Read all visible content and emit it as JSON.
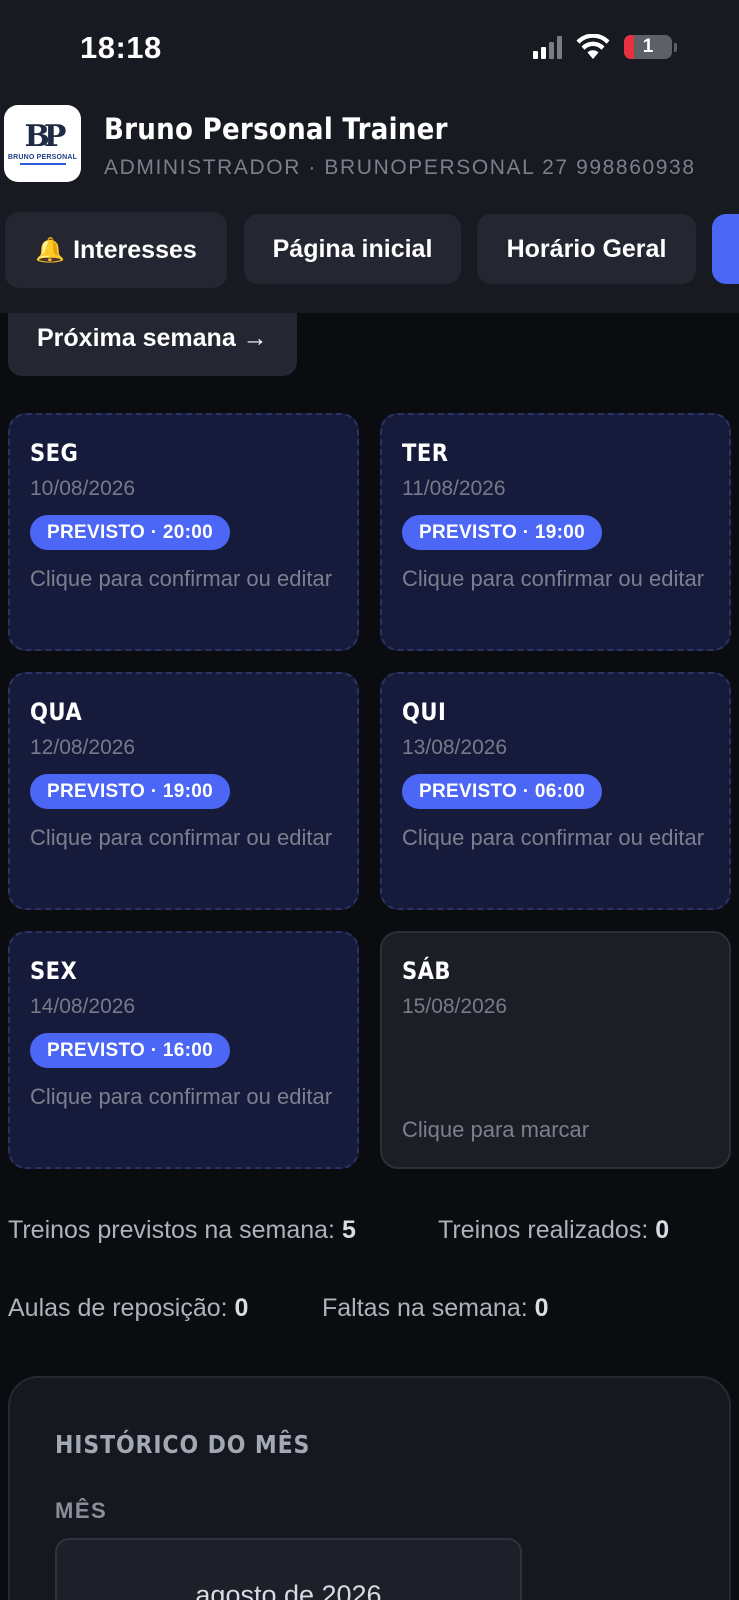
{
  "status_bar": {
    "time": "18:18",
    "battery": "1"
  },
  "header": {
    "logo_text": "BRUNO PERSONAL",
    "title": "Bruno Personal Trainer",
    "subtitle": "ADMINISTRADOR · BRUNOPERSONAL 27 998860938"
  },
  "nav": {
    "interesses": "Interesses",
    "inicial": "Página inicial",
    "horario": "Horário Geral"
  },
  "week_nav": {
    "next": "Próxima semana →"
  },
  "days": [
    {
      "name": "SEG",
      "date": "10/08/2026",
      "badge": "PREVISTO · 20:00",
      "hint": "Clique para confirmar ou editar"
    },
    {
      "name": "TER",
      "date": "11/08/2026",
      "badge": "PREVISTO · 19:00",
      "hint": "Clique para confirmar ou editar"
    },
    {
      "name": "QUA",
      "date": "12/08/2026",
      "badge": "PREVISTO · 19:00",
      "hint": "Clique para confirmar ou editar"
    },
    {
      "name": "QUI",
      "date": "13/08/2026",
      "badge": "PREVISTO · 06:00",
      "hint": "Clique para confirmar ou editar"
    },
    {
      "name": "SEX",
      "date": "14/08/2026",
      "badge": "PREVISTO · 16:00",
      "hint": "Clique para confirmar ou editar"
    },
    {
      "name": "SÁB",
      "date": "15/08/2026",
      "hint": "Clique para marcar"
    }
  ],
  "stats": {
    "previstos_label": "Treinos previstos na semana:",
    "previstos_value": "5",
    "realizados_label": "Treinos realizados:",
    "realizados_value": "0",
    "reposicao_label": "Aulas de reposição:",
    "reposicao_value": "0",
    "faltas_label": "Faltas na semana:",
    "faltas_value": "0"
  },
  "history": {
    "title": "HISTÓRICO DO MÊS",
    "month_label": "MÊS",
    "month_value": "agosto de 2026"
  },
  "colors": {
    "accent": "#4c66f5",
    "card_planned": "#161b3b",
    "card_free": "#1c1e26",
    "background": "#0b0c10"
  }
}
